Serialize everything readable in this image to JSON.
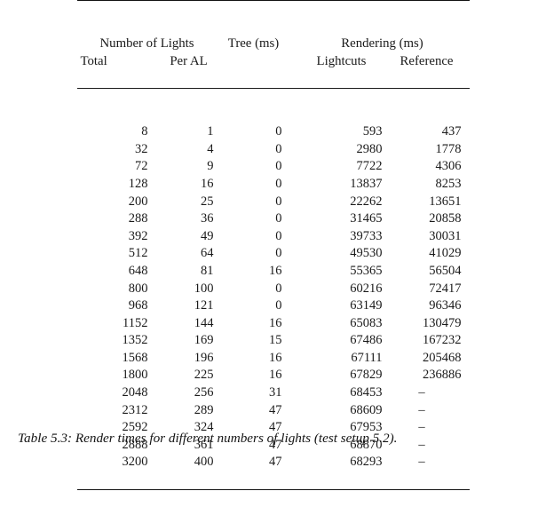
{
  "table": {
    "header_groups": {
      "lights": "Number of Lights",
      "tree": "Tree (ms)",
      "rendering": "Rendering (ms)"
    },
    "header_sub": {
      "total": "Total",
      "per_al": "Per AL",
      "lightcuts": "Lightcuts",
      "reference": "Reference"
    },
    "rows": [
      {
        "total": "8",
        "per_al": "1",
        "tree": "0",
        "lightcuts": "593",
        "reference": "437"
      },
      {
        "total": "32",
        "per_al": "4",
        "tree": "0",
        "lightcuts": "2980",
        "reference": "1778"
      },
      {
        "total": "72",
        "per_al": "9",
        "tree": "0",
        "lightcuts": "7722",
        "reference": "4306"
      },
      {
        "total": "128",
        "per_al": "16",
        "tree": "0",
        "lightcuts": "13837",
        "reference": "8253"
      },
      {
        "total": "200",
        "per_al": "25",
        "tree": "0",
        "lightcuts": "22262",
        "reference": "13651"
      },
      {
        "total": "288",
        "per_al": "36",
        "tree": "0",
        "lightcuts": "31465",
        "reference": "20858"
      },
      {
        "total": "392",
        "per_al": "49",
        "tree": "0",
        "lightcuts": "39733",
        "reference": "30031"
      },
      {
        "total": "512",
        "per_al": "64",
        "tree": "0",
        "lightcuts": "49530",
        "reference": "41029"
      },
      {
        "total": "648",
        "per_al": "81",
        "tree": "16",
        "lightcuts": "55365",
        "reference": "56504"
      },
      {
        "total": "800",
        "per_al": "100",
        "tree": "0",
        "lightcuts": "60216",
        "reference": "72417"
      },
      {
        "total": "968",
        "per_al": "121",
        "tree": "0",
        "lightcuts": "63149",
        "reference": "96346"
      },
      {
        "total": "1152",
        "per_al": "144",
        "tree": "16",
        "lightcuts": "65083",
        "reference": "130479"
      },
      {
        "total": "1352",
        "per_al": "169",
        "tree": "15",
        "lightcuts": "67486",
        "reference": "167232"
      },
      {
        "total": "1568",
        "per_al": "196",
        "tree": "16",
        "lightcuts": "67111",
        "reference": "205468"
      },
      {
        "total": "1800",
        "per_al": "225",
        "tree": "16",
        "lightcuts": "67829",
        "reference": "236886"
      },
      {
        "total": "2048",
        "per_al": "256",
        "tree": "31",
        "lightcuts": "68453",
        "reference": "–"
      },
      {
        "total": "2312",
        "per_al": "289",
        "tree": "47",
        "lightcuts": "68609",
        "reference": "–"
      },
      {
        "total": "2592",
        "per_al": "324",
        "tree": "47",
        "lightcuts": "67953",
        "reference": "–"
      },
      {
        "total": "2888",
        "per_al": "361",
        "tree": "47",
        "lightcuts": "68870",
        "reference": "–"
      },
      {
        "total": "3200",
        "per_al": "400",
        "tree": "47",
        "lightcuts": "68293",
        "reference": "–"
      }
    ]
  },
  "caption": "Table 5.3: Render times for different numbers of lights (test setup 5.2)."
}
